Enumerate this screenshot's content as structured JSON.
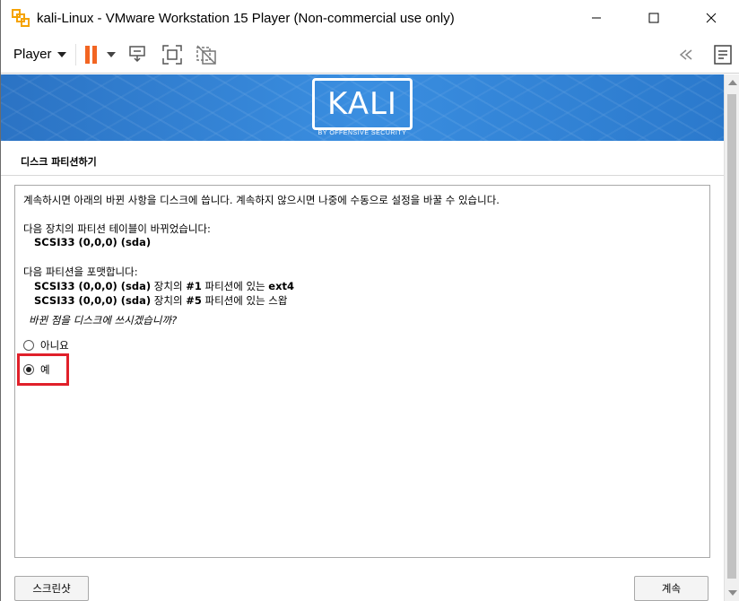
{
  "window": {
    "title": "kali-Linux - VMware Workstation 15 Player (Non-commercial use only)"
  },
  "toolbar": {
    "player_label": "Player"
  },
  "banner": {
    "logo_text": "KALI",
    "logo_subtext": "BY OFFENSIVE SECURITY"
  },
  "installer": {
    "section_title": "디스크 파티션하기",
    "intro": "계속하시면 아래의 바뀐 사항을 디스크에 씁니다. 계속하지 않으시면 나중에 수동으로 설정을 바꿀 수 있습니다.",
    "table_change_label": "다음 장치의 파티션 테이블이 바뀌었습니다:",
    "table_device": "SCSI33 (0,0,0) (sda)",
    "format_label": "다음 파티션을 포맷합니다:",
    "format_items": [
      {
        "device": "SCSI33 (0,0,0) (sda)",
        "mid1": " 장치의 ",
        "num": "#1",
        "mid2": " 파티션에 있는 ",
        "fs": "ext4"
      },
      {
        "device": "SCSI33 (0,0,0) (sda)",
        "mid1": " 장치의 ",
        "num": "#5",
        "mid2": " 파티션에 있는 ",
        "fs": "스왑"
      }
    ],
    "question": "바뀐 점을 디스크에 쓰시겠습니까?",
    "options": [
      {
        "label": "아니요",
        "selected": false
      },
      {
        "label": "예",
        "selected": true
      }
    ],
    "screenshot_button": "스크린샷",
    "continue_button": "계속"
  },
  "colors": {
    "accent_pause": "#f26522",
    "highlight_box": "#e0202a",
    "banner_blue": "#3a8ee0"
  }
}
